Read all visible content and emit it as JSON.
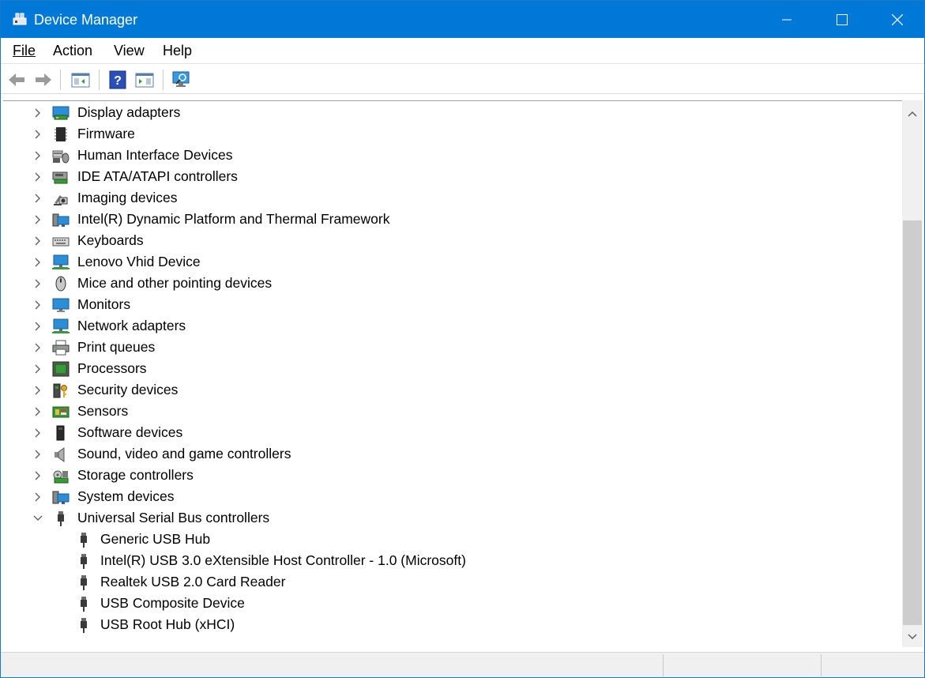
{
  "window": {
    "title": "Device Manager"
  },
  "menu": {
    "file": "File",
    "action": "Action",
    "view": "View",
    "help": "Help"
  },
  "toolbar": {
    "buttons": [
      "back-arrow-icon",
      "forward-arrow-icon",
      "properties-pane-icon",
      "help-icon",
      "update-driver-icon",
      "scan-hardware-icon"
    ]
  },
  "tree": {
    "categories": [
      {
        "label": "Display adapters",
        "icon": "display-adapter-icon"
      },
      {
        "label": "Firmware",
        "icon": "firmware-icon"
      },
      {
        "label": "Human Interface Devices",
        "icon": "hid-icon"
      },
      {
        "label": "IDE ATA/ATAPI controllers",
        "icon": "ide-controller-icon"
      },
      {
        "label": "Imaging devices",
        "icon": "camera-icon"
      },
      {
        "label": "Intel(R) Dynamic Platform and Thermal Framework",
        "icon": "system-device-icon"
      },
      {
        "label": "Keyboards",
        "icon": "keyboard-icon"
      },
      {
        "label": "Lenovo Vhid Device",
        "icon": "network-monitor-icon"
      },
      {
        "label": "Mice and other pointing devices",
        "icon": "mouse-icon"
      },
      {
        "label": "Monitors",
        "icon": "monitor-icon"
      },
      {
        "label": "Network adapters",
        "icon": "network-monitor-icon"
      },
      {
        "label": "Print queues",
        "icon": "printer-icon"
      },
      {
        "label": "Processors",
        "icon": "processor-icon"
      },
      {
        "label": "Security devices",
        "icon": "security-key-icon"
      },
      {
        "label": "Sensors",
        "icon": "sensor-icon"
      },
      {
        "label": "Software devices",
        "icon": "software-device-icon"
      },
      {
        "label": "Sound, video and game controllers",
        "icon": "speaker-icon"
      },
      {
        "label": "Storage controllers",
        "icon": "storage-controller-icon"
      },
      {
        "label": "System devices",
        "icon": "system-device-icon"
      },
      {
        "label": "Universal Serial Bus controllers",
        "icon": "usb-icon",
        "expanded": true
      }
    ],
    "usb_children": [
      "Generic USB Hub",
      "Intel(R) USB 3.0 eXtensible Host Controller - 1.0 (Microsoft)",
      "Realtek USB 2.0 Card Reader",
      "USB Composite Device",
      "USB Root Hub (xHCI)"
    ]
  },
  "colors": {
    "titlebar": "#0078d7",
    "monitor_blue": "#2a8fd6",
    "usb_gray": "#4a4a4a"
  }
}
